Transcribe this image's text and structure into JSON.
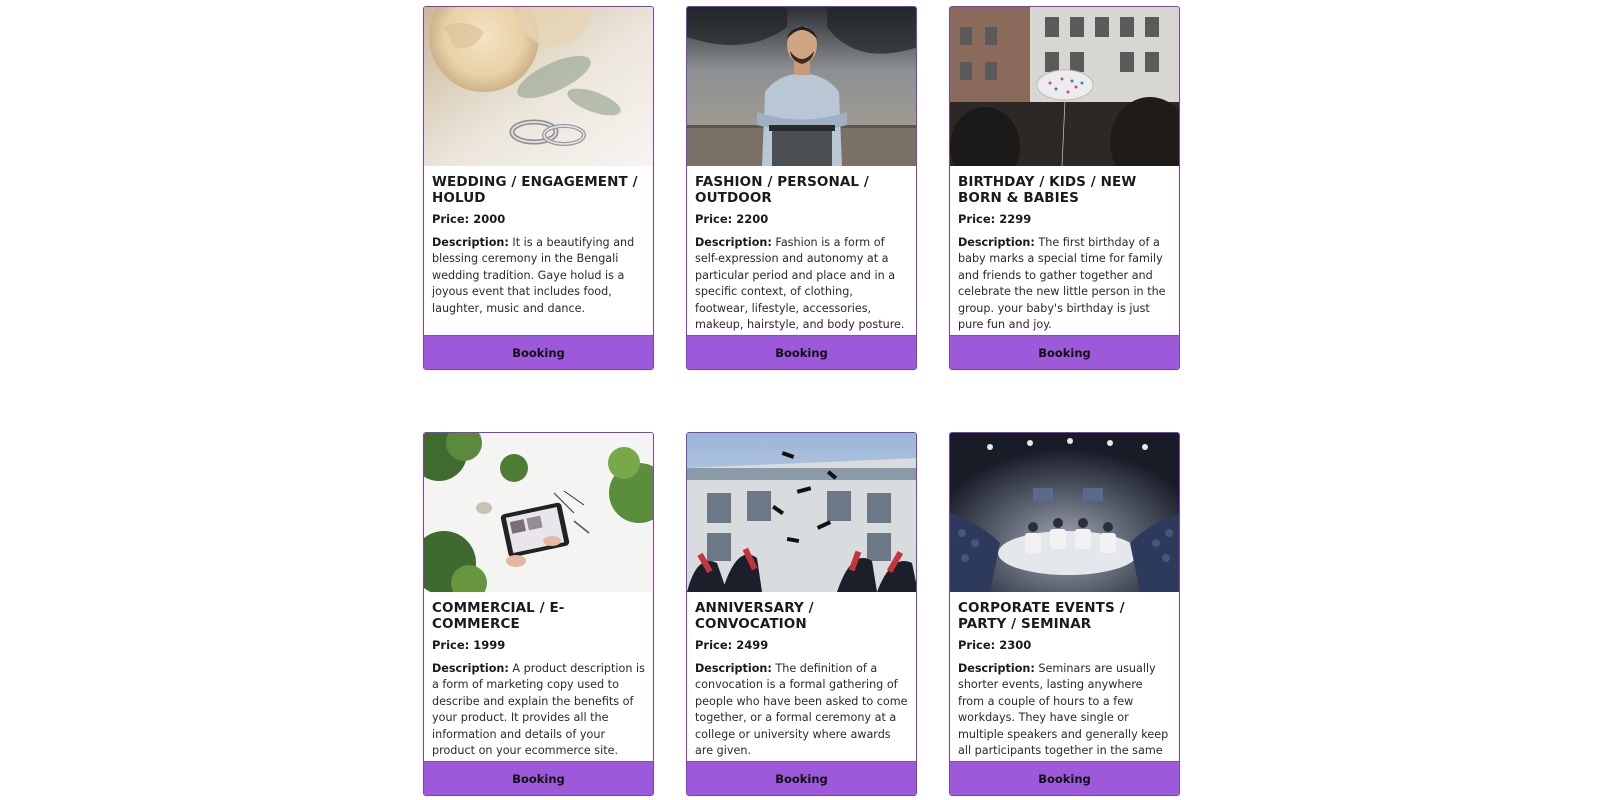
{
  "cards": [
    {
      "title": "WEDDING / ENGAGEMENT / HOLUD",
      "price": "Price: 2000",
      "desc_label": "Description:",
      "desc": "It is a beautifying and blessing ceremony in the Bengali wedding tradition. Gaye holud is a joyous event that includes food, laughter, music and dance.",
      "button": "Booking",
      "image": "wedding-rings-roses-photo"
    },
    {
      "title": "FASHION / PERSONAL / OUTDOOR",
      "price": "Price: 2200",
      "desc_label": "Description:",
      "desc": "Fashion is a form of self-expression and autonomy at a particular period and place and in a specific context, of clothing, footwear, lifestyle, accessories, makeup, hairstyle, and body posture.",
      "button": "Booking",
      "image": "man-portrait-photo"
    },
    {
      "title": "BIRTHDAY / KIDS / NEW BORN & BABIES",
      "price": "Price: 2299",
      "desc_label": "Description:",
      "desc": "The first birthday of a baby marks a special time for family and friends to gather together and celebrate the new little person in the group. your baby's birthday is just pure fun and joy.",
      "button": "Booking",
      "image": "birthday-balloon-photo"
    },
    {
      "title": "COMMERCIAL / E-COMMERCE",
      "price": "Price: 1999",
      "desc_label": "Description:",
      "desc": "A product description is a form of marketing copy used to describe and explain the benefits of your product. It provides all the information and details of your product on your ecommerce site.",
      "button": "Booking",
      "image": "tablet-plants-photo"
    },
    {
      "title": "ANNIVERSARY / CONVOCATION",
      "price": "Price: 2499",
      "desc_label": "Description:",
      "desc": "The definition of a convocation is a formal gathering of people who have been asked to come together, or a formal ceremony at a college or university where awards are given.",
      "button": "Booking",
      "image": "graduation-caps-photo"
    },
    {
      "title": "CORPORATE EVENTS / PARTY / SEMINAR",
      "price": "Price: 2300",
      "desc_label": "Description:",
      "desc": "Seminars are usually shorter events, lasting anywhere from a couple of hours to a few workdays. They have single or multiple speakers and generally keep all participants together in the same space.",
      "button": "Booking",
      "image": "seminar-stage-photo"
    }
  ],
  "colors": {
    "accent": "#9c59d9",
    "border": "#7e3fbf"
  }
}
